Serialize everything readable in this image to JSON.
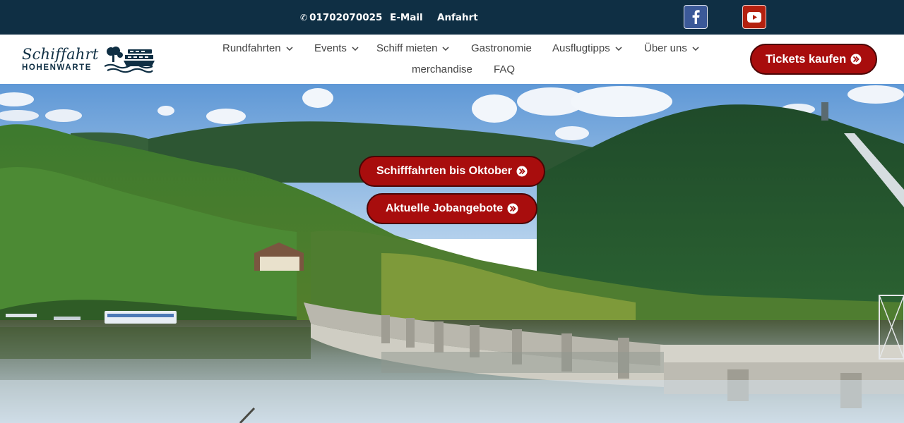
{
  "topbar": {
    "phone": "01702070025",
    "email_label": "E-Mail",
    "route_label": "Anfahrt"
  },
  "header": {
    "logo_title": "Schiffahrt",
    "logo_subtitle": "HOHENWARTE"
  },
  "nav": {
    "items": [
      {
        "label": "Rundfahrten"
      },
      {
        "label": "Events"
      },
      {
        "label": "Schiff mieten"
      },
      {
        "label": "Gastronomie"
      },
      {
        "label": "Ausflugtipps"
      },
      {
        "label": "Über uns"
      },
      {
        "label": "merchandise"
      },
      {
        "label": "FAQ"
      }
    ]
  },
  "tickets_label": "Tickets kaufen",
  "hero": {
    "cta_primary": "Schifffahrten bis Oktober",
    "cta_secondary": "Aktuelle Jobangebote"
  },
  "icons": {
    "phone": "phone-icon",
    "facebook": "facebook-icon",
    "youtube": "youtube-icon",
    "chevron": "chevron-down-icon",
    "arrow": "double-chevron-right-icon"
  },
  "colors": {
    "topbar_bg": "#0f2f44",
    "brand_navy": "#0f2f44",
    "cta_red": "#a80d0d",
    "facebook_blue": "#3b5998",
    "youtube_red": "#b3200f"
  }
}
